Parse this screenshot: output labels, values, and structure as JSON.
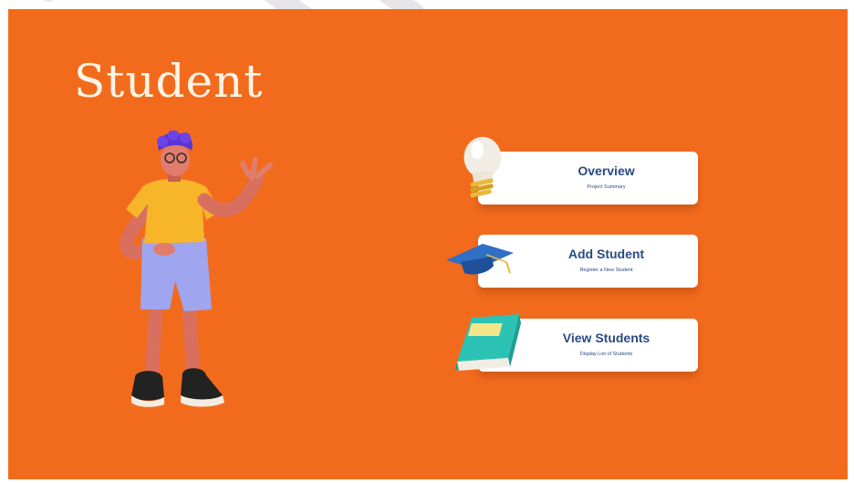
{
  "page": {
    "title": "Student",
    "background_color": "#f26b1d",
    "illustration": "student-character-pointing"
  },
  "menu": [
    {
      "title": "Overview",
      "subtitle": "Project Summary",
      "icon": "lightbulb-icon"
    },
    {
      "title": "Add Student",
      "subtitle": "Register a New Student",
      "icon": "graduation-cap-icon"
    },
    {
      "title": "View Students",
      "subtitle": "Display List of Students",
      "icon": "book-icon"
    }
  ],
  "colors": {
    "accent": "#f26b1d",
    "card_text": "#2a4a82",
    "title_text": "#fff4e6"
  }
}
